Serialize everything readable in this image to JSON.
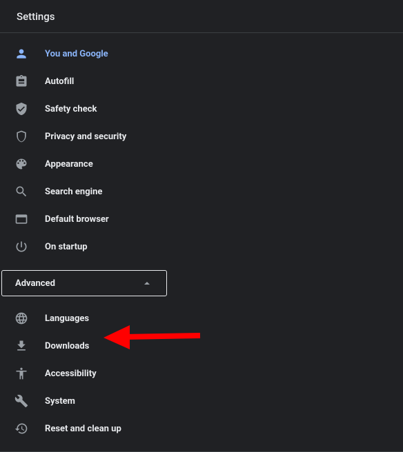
{
  "header": {
    "title": "Settings"
  },
  "nav": {
    "items": [
      {
        "key": "you-and-google",
        "label": "You and Google",
        "active": true
      },
      {
        "key": "autofill",
        "label": "Autofill"
      },
      {
        "key": "safety-check",
        "label": "Safety check"
      },
      {
        "key": "privacy-and-security",
        "label": "Privacy and security"
      },
      {
        "key": "appearance",
        "label": "Appearance"
      },
      {
        "key": "search-engine",
        "label": "Search engine"
      },
      {
        "key": "default-browser",
        "label": "Default browser"
      },
      {
        "key": "on-startup",
        "label": "On startup"
      }
    ],
    "advanced": {
      "label": "Advanced",
      "expanded": true,
      "items": [
        {
          "key": "languages",
          "label": "Languages"
        },
        {
          "key": "downloads",
          "label": "Downloads",
          "highlighted": true
        },
        {
          "key": "accessibility",
          "label": "Accessibility"
        },
        {
          "key": "system",
          "label": "System"
        },
        {
          "key": "reset-and-clean-up",
          "label": "Reset and clean up"
        }
      ]
    }
  },
  "annotation": {
    "arrow_color": "#ff0000",
    "target": "downloads"
  }
}
